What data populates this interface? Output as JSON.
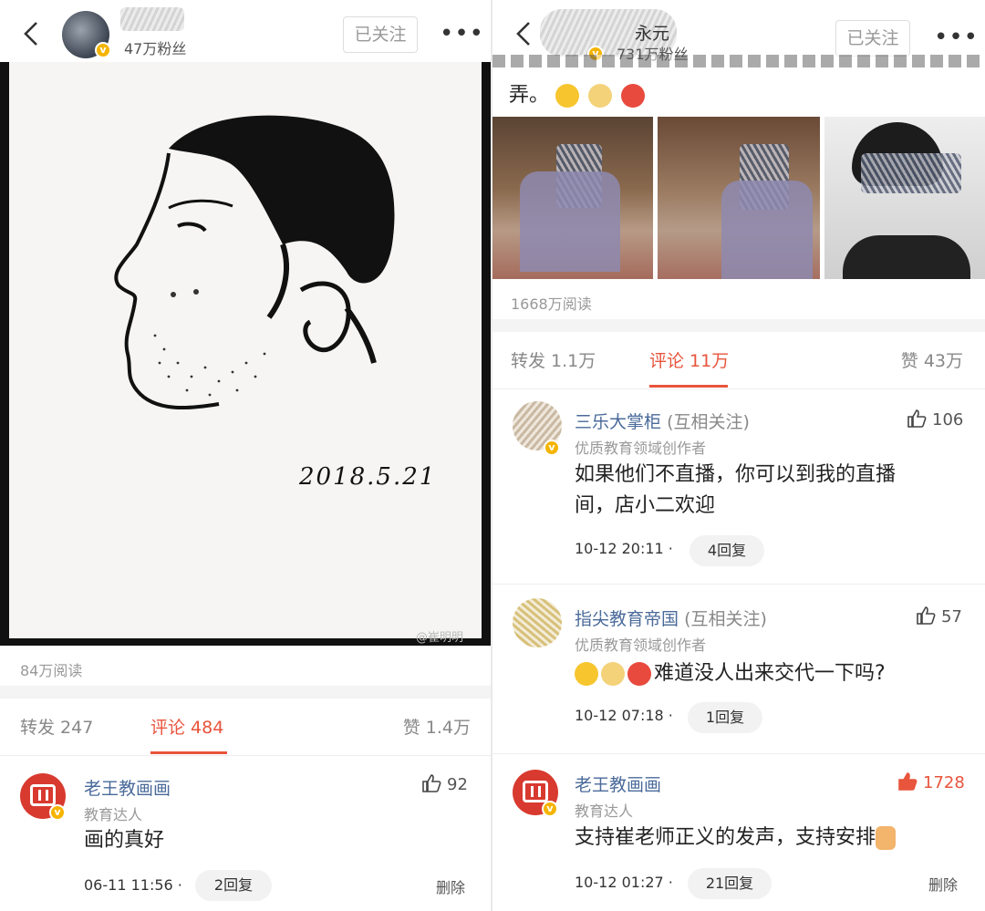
{
  "left": {
    "header": {
      "fans": "47万粉丝",
      "follow_label": "已关注",
      "more": "•••"
    },
    "artwork": {
      "date_text": "2018.5.21",
      "watermark": "@崔明明"
    },
    "reads": "84万阅读",
    "tabs": {
      "repost": "转发 247",
      "comment": "评论 484",
      "like": "赞 1.4万"
    },
    "comment": {
      "username": "老王教画画",
      "tag": "教育达人",
      "text": "画的真好",
      "time": "06-11 11:56 ·",
      "replies": "2回复",
      "likes": "92",
      "delete": "删除"
    }
  },
  "right": {
    "header": {
      "name_tail": "永元",
      "fans": "731万粉丝",
      "follow_label": "已关注",
      "more": "•••"
    },
    "post_snippet": "弄。",
    "reads": "1668万阅读",
    "tabs": {
      "repost": "转发 1.1万",
      "comment": "评论 11万",
      "like": "赞 43万"
    },
    "comments": [
      {
        "username": "三乐大掌柜",
        "mutual": "(互相关注)",
        "tag": "优质教育领域创作者",
        "text_line1": "如果他们不直播，你可以到我的直播",
        "text_line2": "间，店小二欢迎",
        "time": "10-12 20:11 ·",
        "replies": "4回复",
        "likes": "106"
      },
      {
        "username": "指尖教育帝国",
        "mutual": "(互相关注)",
        "tag": "优质教育领域创作者",
        "text": "难道没人出来交代一下吗?",
        "time": "10-12 07:18 ·",
        "replies": "1回复",
        "likes": "57"
      },
      {
        "username": "老王教画画",
        "tag": "教育达人",
        "text": "支持崔老师正义的发声，支持安排",
        "time": "10-12 01:27 ·",
        "replies": "21回复",
        "likes": "1728",
        "delete": "删除"
      }
    ]
  },
  "colors": {
    "accent": "#e8543c",
    "link": "#4a6a9a",
    "muted": "#999999",
    "badge": "#f5b400"
  }
}
